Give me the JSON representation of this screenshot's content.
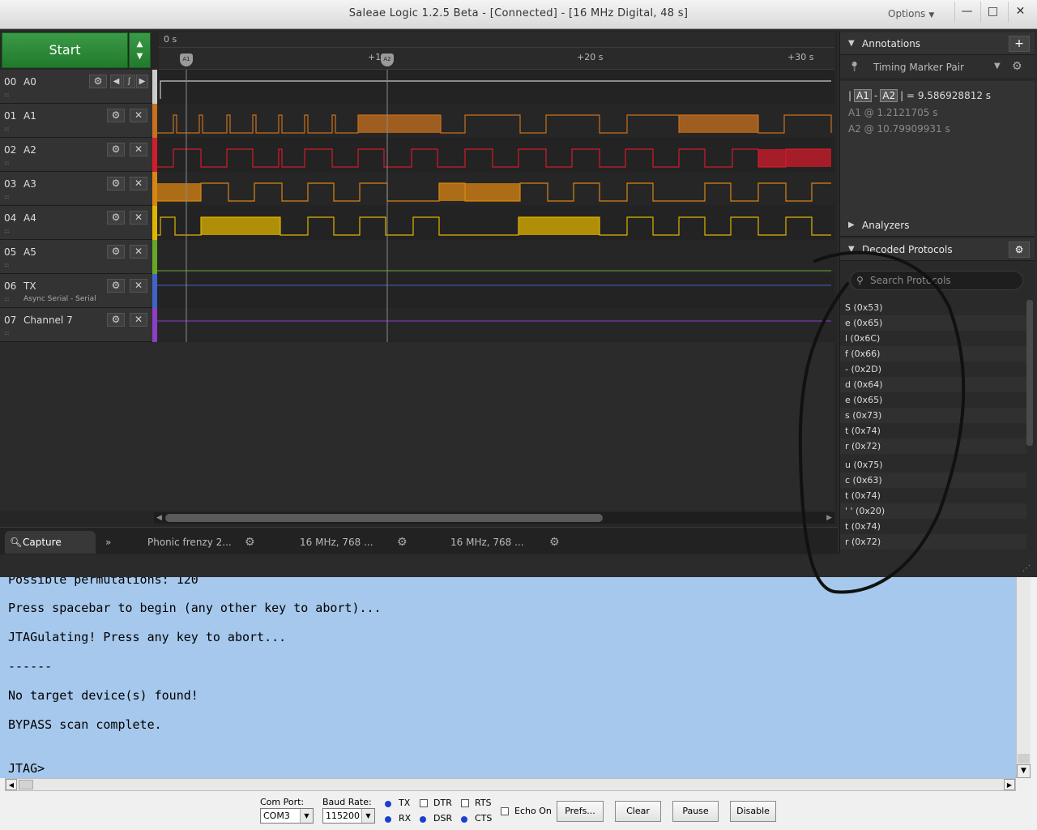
{
  "window": {
    "title": "Saleae Logic 1.2.5 Beta - [Connected] - [16 MHz Digital, 48 s]",
    "options_label": "Options",
    "minimize": "—",
    "maximize": "□",
    "close": "✕"
  },
  "capture": {
    "start_label": "Start",
    "ruler_zero": "0 s",
    "ticks": [
      "+1",
      "+20 s",
      "+30 s"
    ],
    "markers": [
      "A1",
      "A2"
    ]
  },
  "channels": [
    {
      "num": "00",
      "name": "A0",
      "sub": "",
      "color": "#cccccc"
    },
    {
      "num": "01",
      "name": "A1",
      "sub": "",
      "color": "#c8701d"
    },
    {
      "num": "02",
      "name": "A2",
      "sub": "",
      "color": "#d21c2c"
    },
    {
      "num": "03",
      "name": "A3",
      "sub": "",
      "color": "#d98512"
    },
    {
      "num": "04",
      "name": "A4",
      "sub": "",
      "color": "#e0b400"
    },
    {
      "num": "05",
      "name": "A5",
      "sub": "",
      "color": "#66a629"
    },
    {
      "num": "06",
      "name": "TX",
      "sub": "Async Serial - Serial",
      "color": "#3f63c6"
    },
    {
      "num": "07",
      "name": "Channel 7",
      "sub": "",
      "color": "#8a3fc6"
    }
  ],
  "tabs": {
    "capture": "Capture",
    "session1": "Phonic frenzy 2...",
    "session2": "16 MHz, 768 ...",
    "session3": "16 MHz, 768 ..."
  },
  "annotations": {
    "header": "Annotations",
    "sub": "Timing Marker Pair",
    "diff_value": "9.586928812 s",
    "a1_label": "A1",
    "a1_value": "1.2121705 s",
    "a2_label": "A2",
    "a2_value": "10.79909931 s"
  },
  "analyzers": {
    "header": "Analyzers"
  },
  "decoded": {
    "header": "Decoded Protocols",
    "search_placeholder": "Search Protocols",
    "items": [
      "S (0x53)",
      "e (0x65)",
      "l (0x6C)",
      "f (0x66)",
      "- (0x2D)",
      "d (0x64)",
      "e (0x65)",
      "s (0x73)",
      "t (0x74)",
      "r (0x72)",
      "u (0x75)",
      "c (0x63)",
      "t (0x74)",
      "' ' (0x20)",
      "t (0x74)",
      "r (0x72)"
    ]
  },
  "terminal": {
    "lines": [
      "Possible permutations: 120",
      "Press spacebar to begin (any other key to abort)...",
      "JTAGulating! Press any key to abort...",
      "------",
      "No target device(s) found!",
      "BYPASS scan complete.",
      "JTAG>"
    ]
  },
  "serial": {
    "com_port_label": "Com Port:",
    "com_port_value": "COM3",
    "baud_label": "Baud Rate:",
    "baud_value": "115200",
    "tx": "TX",
    "rx": "RX",
    "dtr": "DTR",
    "dsr": "DSR",
    "rts": "RTS",
    "cts": "CTS",
    "echo_on": "Echo On",
    "prefs": "Prefs...",
    "clear": "Clear",
    "pause": "Pause",
    "disable": "Disable"
  }
}
